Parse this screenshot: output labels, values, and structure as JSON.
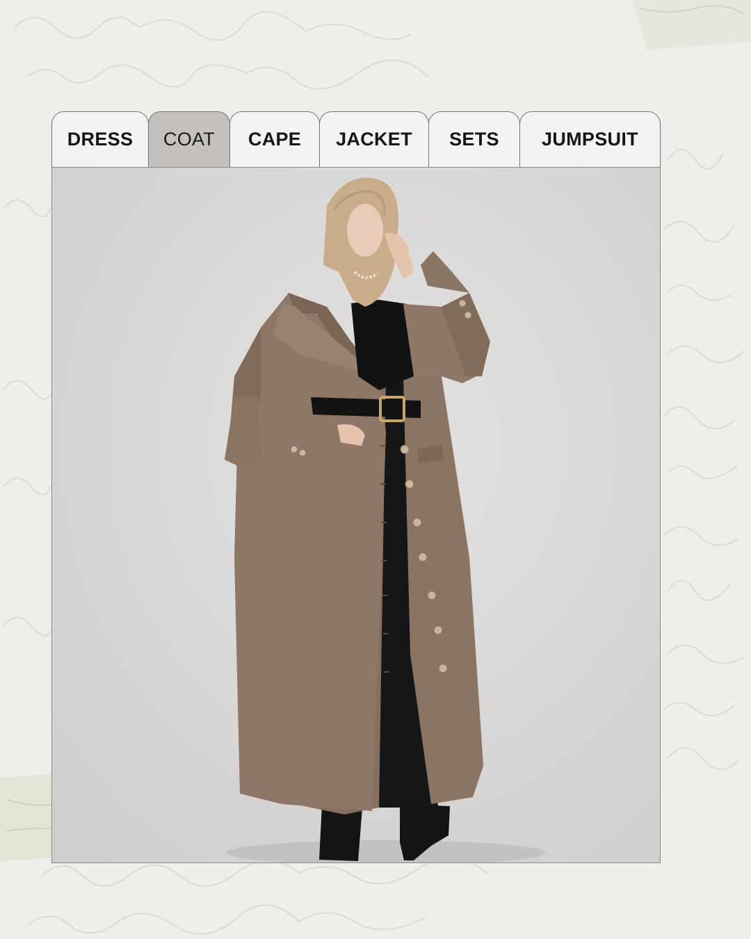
{
  "tabs": [
    {
      "label": "DRESS",
      "active": false
    },
    {
      "label": "COAT",
      "active": true
    },
    {
      "label": "CAPE",
      "active": false
    },
    {
      "label": "JACKET",
      "active": false
    },
    {
      "label": "SETS",
      "active": false
    },
    {
      "label": "JUMPSUIT",
      "active": false
    }
  ],
  "colors": {
    "background": "#efeeeb",
    "tab_active": "#c5c2bd",
    "tab_inactive": "#f3f3f3",
    "photo_backdrop": "#d6d5d3",
    "coat": "#8a7463",
    "scarf": "#c9ac8a"
  }
}
